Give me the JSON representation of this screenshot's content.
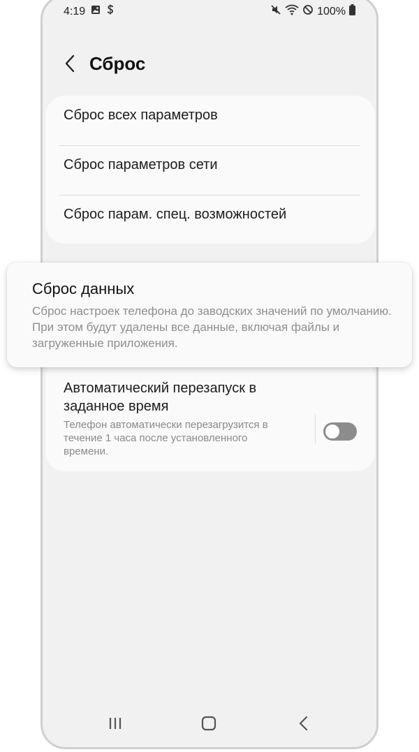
{
  "status": {
    "time": "4:19",
    "battery": "100%",
    "icons_left": [
      "gallery-icon",
      "s-icon"
    ],
    "icons_right": [
      "mute-icon",
      "wifi-icon",
      "dnd-icon",
      "battery-icon"
    ]
  },
  "header": {
    "title": "Сброс"
  },
  "reset_options": [
    {
      "label": "Сброс всех параметров"
    },
    {
      "label": "Сброс параметров сети"
    },
    {
      "label": "Сброс парам. спец. возможностей"
    }
  ],
  "factory_reset": {
    "title": "Сброс данных",
    "description": "Сброс настроек телефона до заводских значений по умолчанию. При этом будут удалены все данные, включая файлы и загруженные приложения."
  },
  "auto_restart": {
    "title": "Автоматический перезапуск в заданное время",
    "description": "Телефон автоматически перезагрузится в течение 1 часа после установленного времени.",
    "enabled": false
  },
  "navigation": [
    "recent-apps",
    "home",
    "back"
  ],
  "colors": {
    "background": "#f1f1f1",
    "card": "#fafafa",
    "secondary_text": "#8e8e8e",
    "toggle_off": "#8c8c8c"
  }
}
